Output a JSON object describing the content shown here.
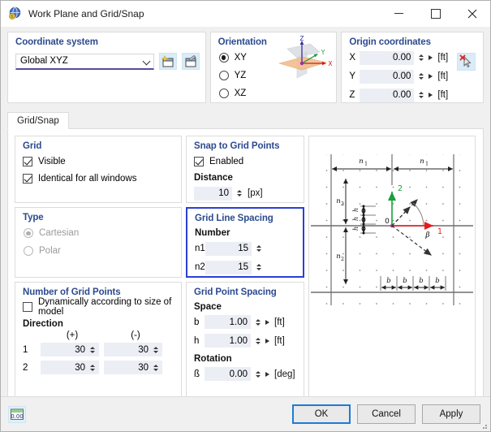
{
  "window": {
    "title": "Work Plane and Grid/Snap",
    "icon": "globe-icon",
    "minimize": "minimize",
    "maximize": "maximize",
    "close": "close"
  },
  "coordinate_system": {
    "title": "Coordinate system",
    "value": "Global XYZ",
    "new_button": "new-coordinate-system",
    "edit_button": "edit-coordinate-system"
  },
  "orientation": {
    "title": "Orientation",
    "options": [
      {
        "label": "XY",
        "selected": true
      },
      {
        "label": "YZ",
        "selected": false
      },
      {
        "label": "XZ",
        "selected": false
      }
    ],
    "figure_labels": {
      "x": "X",
      "y": "Y",
      "z": "Z"
    }
  },
  "origin": {
    "title": "Origin coordinates",
    "rows": [
      {
        "label": "X",
        "value": "0.00",
        "unit": "[ft]"
      },
      {
        "label": "Y",
        "value": "0.00",
        "unit": "[ft]"
      },
      {
        "label": "Z",
        "value": "0.00",
        "unit": "[ft]"
      }
    ],
    "pick_button": "pick-point"
  },
  "tabs": [
    {
      "label": "Grid/Snap",
      "active": true
    }
  ],
  "grid": {
    "title": "Grid",
    "visible": {
      "label": "Visible",
      "checked": true
    },
    "identical": {
      "label": "Identical for all windows",
      "checked": true
    }
  },
  "snap": {
    "title": "Snap to Grid Points",
    "enabled": {
      "label": "Enabled",
      "checked": true
    },
    "distance_label": "Distance",
    "distance_value": "10",
    "distance_unit": "[px]"
  },
  "type": {
    "title": "Type",
    "options": [
      {
        "label": "Cartesian",
        "selected": true,
        "disabled": true
      },
      {
        "label": "Polar",
        "selected": false,
        "disabled": true
      }
    ]
  },
  "grid_line_spacing": {
    "title": "Grid Line Spacing",
    "number_label": "Number",
    "rows": [
      {
        "label": "n1",
        "value": "15"
      },
      {
        "label": "n2",
        "value": "15"
      }
    ],
    "highlighted": true,
    "highlight_color": "#2b3fd4"
  },
  "number_of_grid_points": {
    "title": "Number of Grid Points",
    "dynamic": {
      "label": "Dynamically according to size of model",
      "checked": false
    },
    "direction_label": "Direction",
    "columns": [
      "(+)",
      "(-)"
    ],
    "rows": [
      {
        "label": "1",
        "plus": "30",
        "minus": "30"
      },
      {
        "label": "2",
        "plus": "30",
        "minus": "30"
      }
    ]
  },
  "grid_point_spacing": {
    "title": "Grid Point Spacing",
    "space_label": "Space",
    "space_rows": [
      {
        "label": "b",
        "value": "1.00",
        "unit": "[ft]"
      },
      {
        "label": "h",
        "value": "1.00",
        "unit": "[ft]"
      }
    ],
    "rotation_label": "Rotation",
    "rotation_row": {
      "label": "ß",
      "value": "0.00",
      "unit": "[deg]"
    }
  },
  "figure": {
    "name": "grid-definition-diagram",
    "labels": {
      "n1_left": "n₁",
      "n1_right": "n₁",
      "n2_upper": "n₂",
      "n2_lower": "n₂",
      "h1": "h",
      "h2": "h",
      "h3": "h",
      "origin": "0",
      "axis1": "1",
      "axis2": "2",
      "beta": "β",
      "b": [
        "b",
        "b",
        "b",
        "b"
      ]
    },
    "colors": {
      "axis1": "#e8191b",
      "axis2": "#18a03c"
    }
  },
  "footer": {
    "units_button": "units-settings",
    "units_text": "0.00",
    "buttons": [
      {
        "label": "OK",
        "primary": true
      },
      {
        "label": "Cancel",
        "primary": false
      },
      {
        "label": "Apply",
        "primary": false
      }
    ]
  }
}
